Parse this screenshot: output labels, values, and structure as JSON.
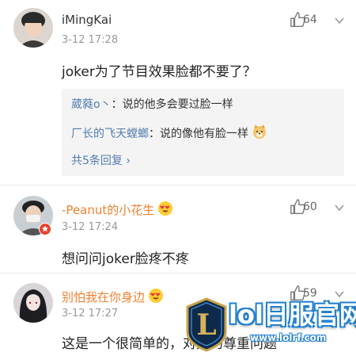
{
  "comments": [
    {
      "username": "iMingKai",
      "time": "3-12 17:28",
      "likes": "64",
      "text": "joker为了节目效果脸都不要了？",
      "replies": [
        {
          "name": "葳蕤o丶",
          "text": "：说的他多会要过脸一样"
        },
        {
          "name": "厂长的飞天螳螂",
          "text": "：说的像他有脸一样"
        }
      ],
      "more_replies": "共5条回复 ›"
    },
    {
      "username": "-Peanut的小花生",
      "time": "3-12 17:24",
      "likes": "60",
      "text": "想问问joker脸疼不疼"
    },
    {
      "username": "别怕我在你身边",
      "time": "3-12 17:27",
      "likes": "59",
      "text": "这是一个很简单的，对大的尊重问题"
    }
  ],
  "colors": {
    "username_blue": "#507daf",
    "username_orange": "#f18030",
    "reply_bg": "#f4f4f4"
  },
  "watermark": {
    "logo_letter": "L",
    "text": "lol日服官网",
    "url": "www.lolrf.com"
  }
}
